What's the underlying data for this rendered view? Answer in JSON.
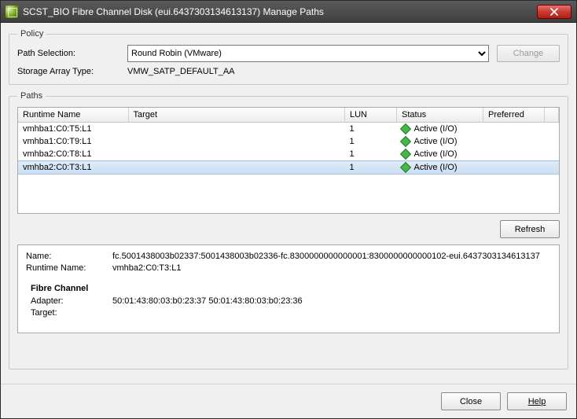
{
  "window": {
    "title": "SCST_BIO Fibre Channel Disk (eui.6437303134613137) Manage Paths"
  },
  "policy": {
    "legend": "Policy",
    "path_selection_label": "Path Selection:",
    "path_selection_value": "Round Robin (VMware)",
    "change_label": "Change",
    "storage_array_type_label": "Storage Array Type:",
    "storage_array_type_value": "VMW_SATP_DEFAULT_AA"
  },
  "paths": {
    "legend": "Paths",
    "columns": {
      "runtime_name": "Runtime Name",
      "target": "Target",
      "lun": "LUN",
      "status": "Status",
      "preferred": "Preferred"
    },
    "rows": [
      {
        "runtime_name": "vmhba1:C0:T5:L1",
        "target": "",
        "lun": "1",
        "status": "Active (I/O)",
        "preferred": "",
        "selected": false
      },
      {
        "runtime_name": "vmhba1:C0:T9:L1",
        "target": "",
        "lun": "1",
        "status": "Active (I/O)",
        "preferred": "",
        "selected": false
      },
      {
        "runtime_name": "vmhba2:C0:T8:L1",
        "target": "",
        "lun": "1",
        "status": "Active (I/O)",
        "preferred": "",
        "selected": false
      },
      {
        "runtime_name": "vmhba2:C0:T3:L1",
        "target": "",
        "lun": "1",
        "status": "Active (I/O)",
        "preferred": "",
        "selected": true
      }
    ],
    "refresh_label": "Refresh"
  },
  "details": {
    "name_label": "Name:",
    "name_value": "fc.5001438003b02337:5001438003b02336-fc.8300000000000001:8300000000000102-eui.6437303134613137",
    "runtime_name_label": "Runtime Name:",
    "runtime_name_value": "vmhba2:C0:T3:L1",
    "fc_heading": "Fibre Channel",
    "adapter_label": "Adapter:",
    "adapter_value": "50:01:43:80:03:b0:23:37 50:01:43:80:03:b0:23:36",
    "target_label": "Target:",
    "target_value": ""
  },
  "footer": {
    "close_label": "Close",
    "help_label": "Help"
  }
}
